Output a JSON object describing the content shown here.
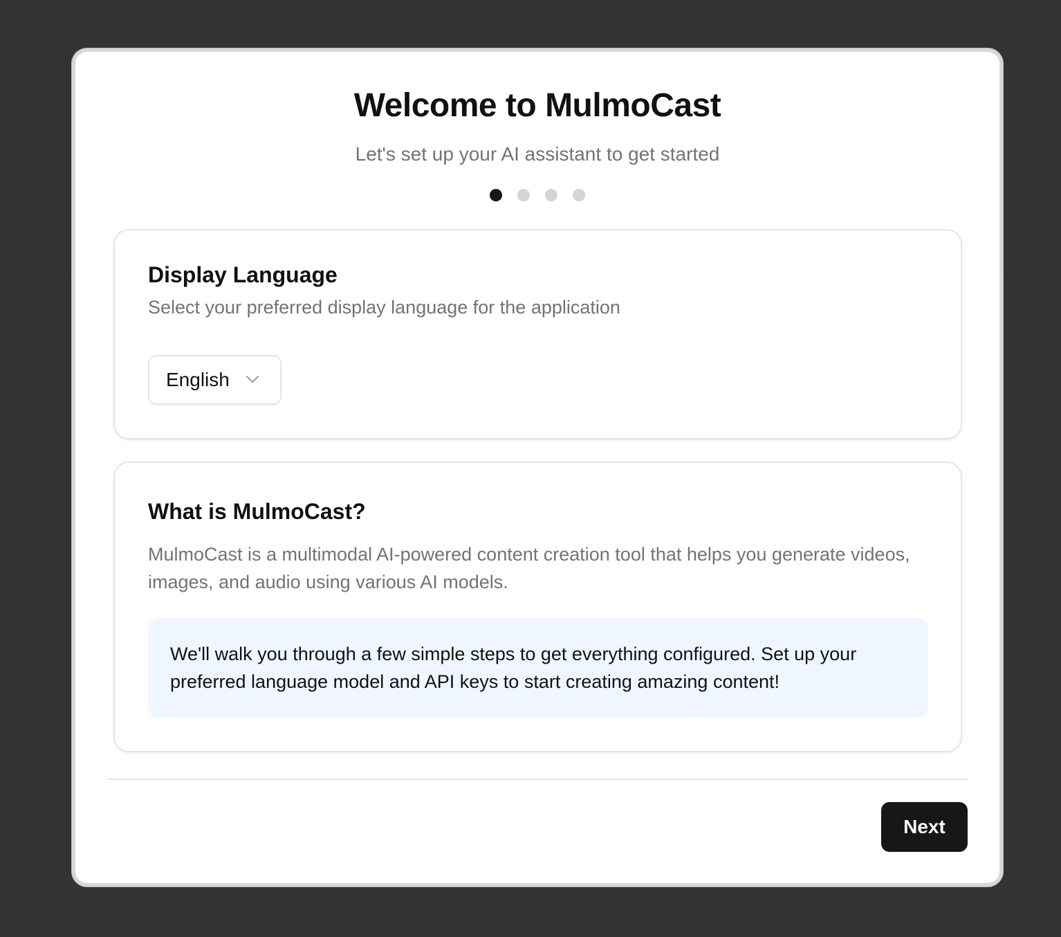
{
  "dialog": {
    "title": "Welcome to MulmoCast",
    "subtitle": "Let's set up your AI assistant to get started",
    "steps": {
      "total": 4,
      "current": 1
    }
  },
  "language_card": {
    "title": "Display Language",
    "description": "Select your preferred display language for the application",
    "select": {
      "value": "English",
      "icon": "chevron-down-icon"
    }
  },
  "about_card": {
    "title": "What is MulmoCast?",
    "description": "MulmoCast is a multimodal AI-powered content creation tool that helps you generate videos, images, and audio using various AI models.",
    "info": "We'll walk you through a few simple steps to get everything configured. Set up your preferred language model and API keys to start creating amazing content!"
  },
  "footer": {
    "next_label": "Next"
  },
  "colors": {
    "backdrop": "#333333",
    "primary": "#171717",
    "muted_text": "#737373",
    "info_bg": "#eff6ff",
    "dot_inactive": "#d4d4d4"
  }
}
